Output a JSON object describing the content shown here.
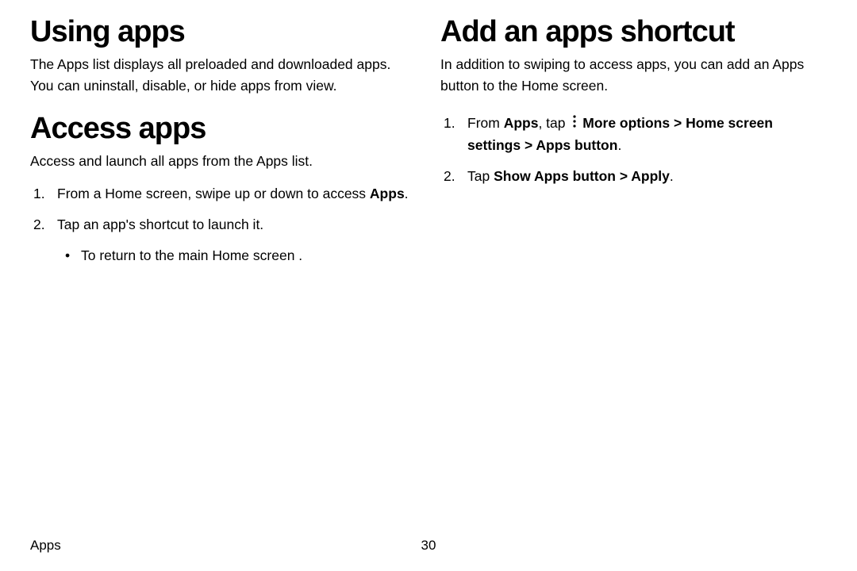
{
  "left": {
    "h1": "Using apps",
    "intro": "The Apps list displays all preloaded and downloaded apps. You can uninstall, disable, or hide apps from view.",
    "h2": "Access apps",
    "lead": "Access and launch all apps from the Apps list.",
    "step1_a": "From a Home screen, swipe up or down to access ",
    "step1_b": "Apps",
    "step1_c": ".",
    "step2": "Tap an app's shortcut to launch it.",
    "bullet1": "To return to the main Home screen ."
  },
  "right": {
    "h1": "Add an apps shortcut",
    "intro": "In addition to swiping to access apps, you can add an Apps button to the Home screen.",
    "step1_a": "From ",
    "step1_b": "Apps",
    "step1_c": ", tap ",
    "step1_d": "More options",
    "step1_e": " > ",
    "step1_f": "Home screen settings",
    "step1_g": " > ",
    "step1_h": "Apps button",
    "step1_i": ".",
    "step2_a": "Tap ",
    "step2_b": "Show Apps button",
    "step2_c": " > ",
    "step2_d": "Apply",
    "step2_e": "."
  },
  "footer": {
    "section": "Apps",
    "page": "30"
  }
}
